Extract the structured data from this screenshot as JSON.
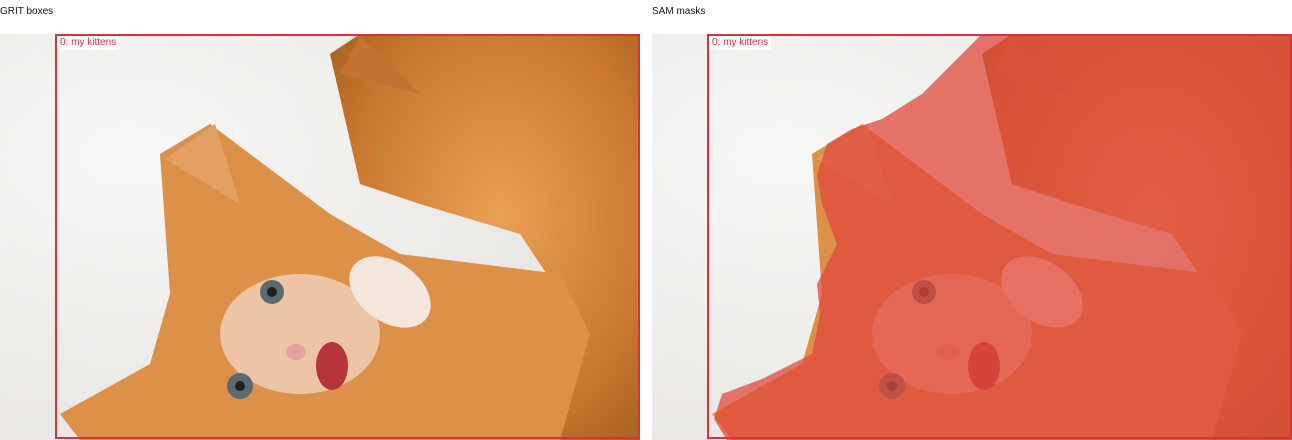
{
  "panels": [
    {
      "title": "GRIT boxes",
      "box_label": "0: my kittens"
    },
    {
      "title": "SAM masks",
      "box_label": "0: my kittens"
    }
  ],
  "colors": {
    "box_stroke": "#d2353d",
    "mask_fill": "#e0483c",
    "background": "#efefef",
    "fur": "#d9893c"
  }
}
